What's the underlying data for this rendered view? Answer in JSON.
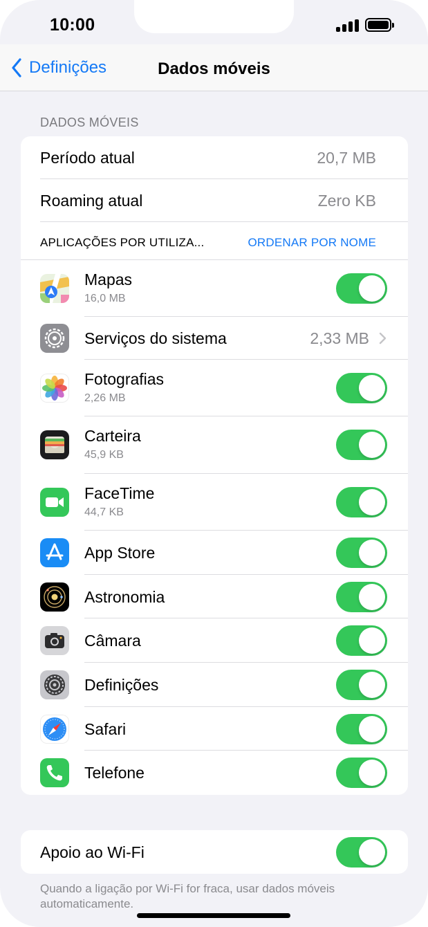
{
  "status_bar": {
    "time": "10:00"
  },
  "nav": {
    "back_label": "Definições",
    "title": "Dados móveis"
  },
  "section_header": "DADOS MÓVEIS",
  "usage": {
    "current_period_label": "Período atual",
    "current_period_value": "20,7 MB",
    "roaming_label": "Roaming atual",
    "roaming_value": "Zero KB"
  },
  "apps_header": {
    "label": "APLICAÇÕES POR UTILIZA...",
    "sort_action": "ORDENAR POR NOME"
  },
  "apps": [
    {
      "name": "Mapas",
      "usage": "16,0 MB",
      "icon": "maps-icon",
      "enabled": true
    },
    {
      "name": "Serviços do sistema",
      "usage": "2,33 MB",
      "icon": "system-services-icon"
    },
    {
      "name": "Fotografias",
      "usage": "2,26 MB",
      "icon": "photos-icon",
      "enabled": true
    },
    {
      "name": "Carteira",
      "usage": "45,9 KB",
      "icon": "wallet-icon",
      "enabled": true
    },
    {
      "name": "FaceTime",
      "usage": "44,7 KB",
      "icon": "facetime-icon",
      "enabled": true
    },
    {
      "name": "App Store",
      "icon": "app-store-icon",
      "enabled": true
    },
    {
      "name": "Astronomia",
      "icon": "astronomy-icon",
      "enabled": true
    },
    {
      "name": "Câmara",
      "icon": "camera-icon",
      "enabled": true
    },
    {
      "name": "Definições",
      "icon": "settings-icon",
      "enabled": true
    },
    {
      "name": "Safari",
      "icon": "safari-icon",
      "enabled": true
    },
    {
      "name": "Telefone",
      "icon": "phone-icon",
      "enabled": true
    }
  ],
  "wifi_assist": {
    "label": "Apoio ao Wi-Fi",
    "enabled": true,
    "footer": "Quando a ligação por Wi-Fi for fraca, usar dados móveis automaticamente."
  },
  "colors": {
    "accent": "#1479f6",
    "toggle_on": "#34c759",
    "background": "#f2f2f7",
    "secondary_text": "#8a8a8e"
  }
}
